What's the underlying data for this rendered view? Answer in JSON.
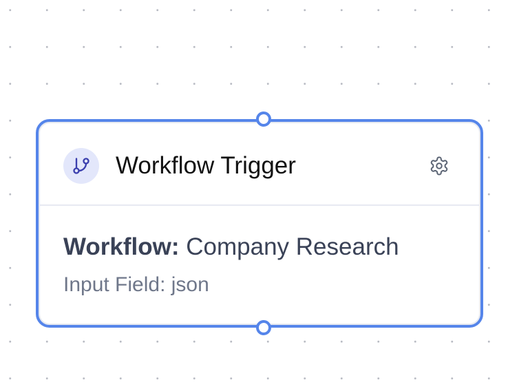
{
  "node": {
    "title": "Workflow Trigger",
    "workflow_label": "Workflow:",
    "workflow_value": "Company Research",
    "input_label": "Input Field:",
    "input_value": "json",
    "header_icon": "git-branch-icon",
    "settings_icon": "gear-icon",
    "selected": true
  },
  "colors": {
    "accent": "#5585ea",
    "icon_background": "#e3e7fb",
    "icon_stroke": "#3b3fae",
    "title_text": "#111111",
    "body_text": "#3a4257",
    "muted_text": "#6f778a",
    "canvas_dots": "#b9bcc4"
  }
}
